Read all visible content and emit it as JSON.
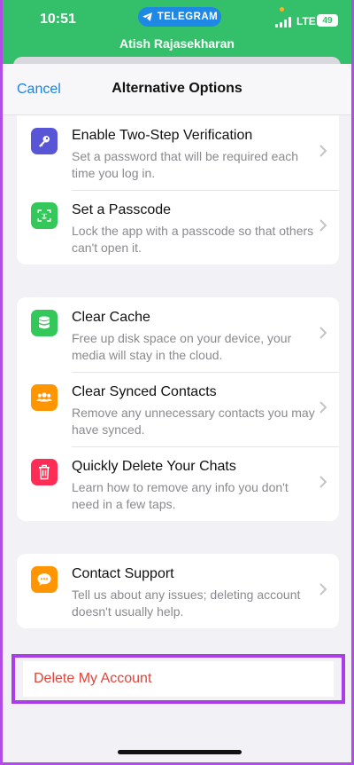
{
  "status_bar": {
    "time": "10:51",
    "app_pill": "TELEGRAM",
    "caller_name": "Atish Rajasekharan",
    "network": "LTE",
    "battery": "49"
  },
  "nav": {
    "cancel_label": "Cancel",
    "title": "Alternative Options"
  },
  "groups": [
    {
      "items": [
        {
          "title": "Enable Two-Step Verification",
          "subtitle": "Set a password that will be required each time you log in.",
          "icon": "key-icon",
          "color": "#5856d6"
        },
        {
          "title": "Set a Passcode",
          "subtitle": "Lock the app with a passcode so that others can't open it.",
          "icon": "face-id-icon",
          "color": "#34c759"
        }
      ]
    },
    {
      "items": [
        {
          "title": "Clear Cache",
          "subtitle": "Free up disk space on your device, your media will stay in the cloud.",
          "icon": "database-icon",
          "color": "#34c759"
        },
        {
          "title": "Clear Synced Contacts",
          "subtitle": "Remove any unnecessary contacts you may have synced.",
          "icon": "contacts-icon",
          "color": "#ff9500"
        },
        {
          "title": "Quickly Delete Your Chats",
          "subtitle": "Learn how to remove any info you don't need in a few taps.",
          "icon": "trash-icon",
          "color": "#ff2d55"
        }
      ]
    },
    {
      "items": [
        {
          "title": "Contact Support",
          "subtitle": "Tell us about any issues; deleting account doesn't usually help.",
          "icon": "chat-bubble-icon",
          "color": "#ff9500"
        }
      ]
    }
  ],
  "delete_label": "Delete My Account"
}
